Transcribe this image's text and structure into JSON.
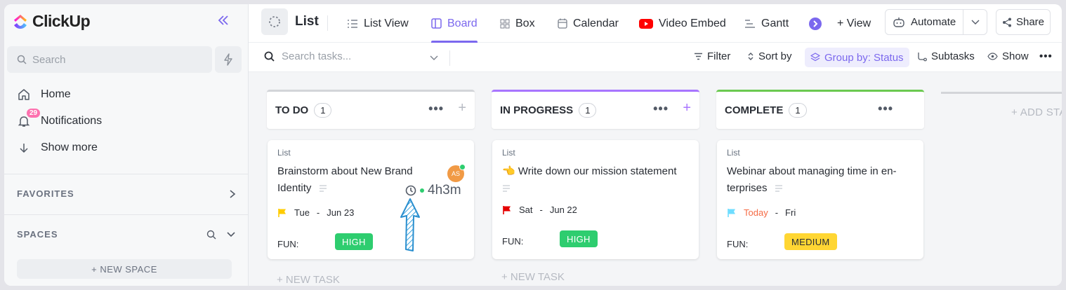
{
  "sidebar": {
    "logo_text": "ClickUp",
    "search_placeholder": "Search",
    "nav": [
      {
        "label": "Home",
        "icon": "home-icon"
      },
      {
        "label": "Notifications",
        "icon": "bell-icon",
        "badge": "29"
      },
      {
        "label": "Show more",
        "icon": "arrow-down-icon"
      }
    ],
    "favorites_label": "FAVORITES",
    "spaces_label": "SPACES",
    "new_space_label": "+ NEW SPACE"
  },
  "header": {
    "list_title": "List",
    "tabs": [
      {
        "label": "List View",
        "icon": "list-icon"
      },
      {
        "label": "Board",
        "icon": "board-icon",
        "active": true
      },
      {
        "label": "Box",
        "icon": "box-icon"
      },
      {
        "label": "Calendar",
        "icon": "calendar-icon"
      },
      {
        "label": "Video Embed",
        "icon": "youtube-icon"
      },
      {
        "label": "Gantt",
        "icon": "gantt-icon"
      }
    ],
    "add_view_label": "+ View",
    "automate_label": "Automate",
    "share_label": "Share"
  },
  "toolbar": {
    "search_placeholder": "Search tasks...",
    "filter_label": "Filter",
    "sort_label": "Sort by",
    "group_label": "Group by: Status",
    "subtasks_label": "Subtasks",
    "show_label": "Show"
  },
  "board": {
    "columns": [
      {
        "name": "TO DO",
        "count": "1",
        "color": "#d3d5d9",
        "card": {
          "list": "List",
          "title": "Brainstorm about New Brand Identity",
          "date_start": "Tue",
          "date_end": "Jun 23",
          "flag_color": "#ffcc00",
          "fun_label": "FUN:",
          "tag": "HIGH",
          "tag_color": "#2ecd6f",
          "avatar_initials": "AS",
          "timer": "4h3m"
        }
      },
      {
        "name": "IN PROGRESS",
        "count": "1",
        "color": "#a875ff",
        "card": {
          "list": "List",
          "title": "👈 Write down our mission statement",
          "date_start": "Sat",
          "date_end": "Jun 22",
          "flag_color": "#e50000",
          "fun_label": "FUN:",
          "tag": "HIGH",
          "tag_color": "#2ecd6f"
        }
      },
      {
        "name": "COMPLETE",
        "count": "1",
        "color": "#6bc950",
        "card": {
          "list": "List",
          "title": "Webinar about managing time in en-terprises",
          "date_start": "Today",
          "date_end": "Fri",
          "flag_color": "#6fddff",
          "fun_label": "FUN:",
          "tag": "MEDIUM",
          "tag_color": "#ffd633"
        }
      }
    ],
    "new_task_label": "+ NEW TASK",
    "add_status_label": "+ ADD STA"
  }
}
